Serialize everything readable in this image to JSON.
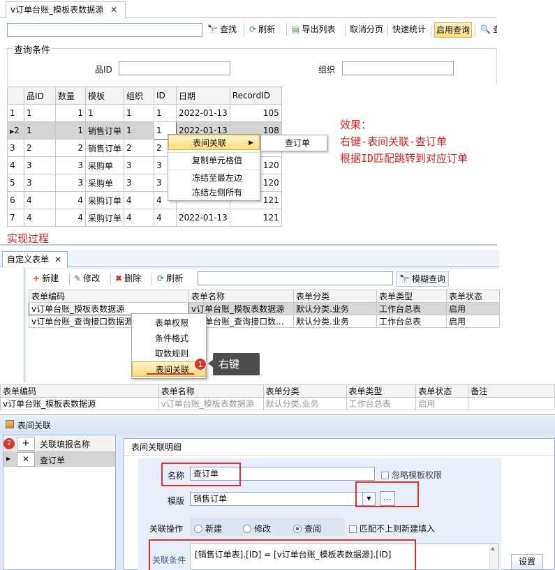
{
  "top": {
    "tab_title": "v订单台账_模板表数据源",
    "tab_close": "✕",
    "toolbar": {
      "search": "查找",
      "refresh": "刷新",
      "export": "导出列表",
      "cancel_page": "取消分页",
      "quick_stats": "快速统计",
      "enable_query": "启用查询",
      "extra": "查"
    },
    "icons": {
      "search": "binoculars-icon",
      "refresh": "refresh-icon",
      "export": "export-icon",
      "magnifier": "magnifier-icon"
    },
    "query_group": "查询条件",
    "field_product": "品ID",
    "field_org": "组织",
    "grid": {
      "headers": [
        "品ID",
        "数量",
        "模板",
        "组织",
        "ID",
        "日期",
        "RecordID"
      ],
      "rows": [
        {
          "n": "1",
          "c": [
            "1",
            "1",
            "1",
            "1",
            "1",
            "2022-01-13",
            "105"
          ]
        },
        {
          "n": "2",
          "c": [
            "1",
            "1",
            "销售订单",
            "1",
            "1",
            "2022-01-13",
            "108"
          ]
        },
        {
          "n": "3",
          "c": [
            "2",
            "2",
            "销售订单",
            "2",
            "2",
            "",
            ""
          ]
        },
        {
          "n": "4",
          "c": [
            "3",
            "3",
            "采购单",
            "3",
            "3",
            "",
            "120"
          ]
        },
        {
          "n": "5",
          "c": [
            "3",
            "3",
            "采购单",
            "3",
            "3",
            "",
            "120"
          ]
        },
        {
          "n": "6",
          "c": [
            "4",
            "4",
            "采购订单",
            "4",
            "4",
            "",
            "121"
          ]
        },
        {
          "n": "7",
          "c": [
            "4",
            "4",
            "采购订单",
            "4",
            "4",
            "2022-01-13",
            "121"
          ]
        }
      ]
    },
    "context_menu": {
      "items": [
        "表间关联",
        "复制单元格值",
        "冻结至最左边",
        "冻结左侧所有"
      ],
      "submenu": "查订单"
    },
    "note": [
      "效果：",
      "右键-表间关联-查订单",
      "根据ID匹配跳转到对应订单"
    ]
  },
  "process_label": "实现过程",
  "middle": {
    "tab_title": "自定义表单",
    "tab_close": "✕",
    "toolbar": {
      "new": "新建",
      "edit": "修改",
      "delete": "删除",
      "refresh": "刷新",
      "fuzzy": "模糊查询"
    },
    "icons": {
      "new": "plus-icon",
      "edit": "pencil-icon",
      "delete": "delete-icon",
      "refresh": "refresh-icon",
      "fuzzy": "binoculars-icon"
    },
    "headers": [
      "表单编码",
      "表单名称",
      "表单分类",
      "表单类型",
      "表单状态"
    ],
    "rows": [
      [
        "v订单台账_模板表数据源",
        "v订单台账_模板表数据源",
        "默认分类.业务",
        "工作台总表",
        "启用"
      ],
      [
        "v订单台账_查询接口数据源",
        "v订单台账_查询接口数...",
        "默认分类.业务",
        "工作台总表",
        "启用"
      ]
    ],
    "menu": [
      "表单权限",
      "条件格式",
      "取数规则",
      "表间关联"
    ],
    "badge1": "1",
    "callout": "右键"
  },
  "lower": {
    "headers": [
      "表单编码",
      "表单名称",
      "表单分类",
      "表单类型",
      "表单状态",
      "备注"
    ],
    "row": [
      "v订单台账_模板表数据源",
      "v订单台账_模板表数据源",
      "默认分类.业务",
      "工作台总表",
      "启用",
      ""
    ]
  },
  "dialog": {
    "title": "表间关联",
    "badge2": "2",
    "left_header": "关联填报名称",
    "add": "+",
    "remove": "✕",
    "left_item": "查订单",
    "detail_title": "表间关联明细",
    "name_label": "名称",
    "name_value": "查订单",
    "ignore_perm": "忽略模板权限",
    "template_label": "模版",
    "template_value": "销售订单",
    "ellipsis": "...",
    "op_label": "关联操作",
    "ops": [
      "新建",
      "修改",
      "查阅"
    ],
    "nomatch": "匹配不上则新建填入",
    "cond_label": "关联条件",
    "cond_value": "[销售订单表].[ID] = [v订单台账_模板表数据源].[ID]",
    "settings": "设置"
  }
}
